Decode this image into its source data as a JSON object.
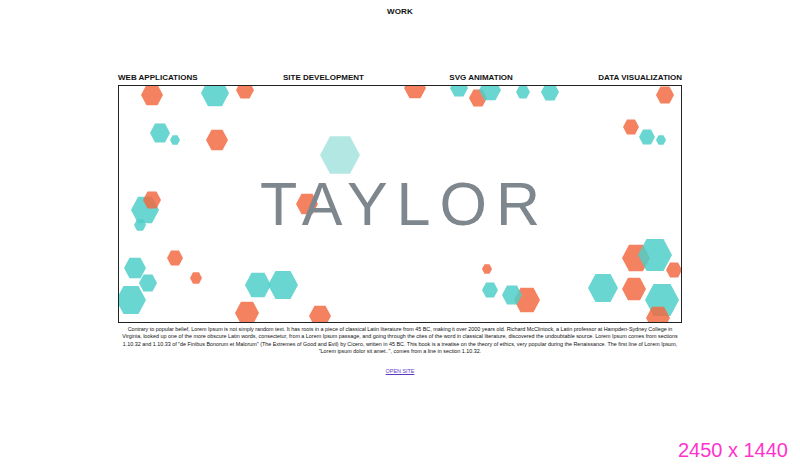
{
  "header": {
    "title": "WORK"
  },
  "categories": [
    {
      "label": "WEB APPLICATIONS"
    },
    {
      "label": "SITE DEVELOPMENT"
    },
    {
      "label": "SVG ANIMATION"
    },
    {
      "label": "DATA VISUALIZATION"
    }
  ],
  "hero": {
    "title": "TAYLOR",
    "shapes": [
      {
        "color": "#f26b43"
      },
      {
        "color": "#4fcfc9"
      },
      {
        "color": "#f26b43"
      },
      {
        "color": "#f26b43"
      },
      {
        "color": "#4fcfc9"
      },
      {
        "color": "#f26b43"
      },
      {
        "color": "#4fcfc9"
      },
      {
        "color": "#4fcfc9"
      },
      {
        "color": "#4fcfc9"
      },
      {
        "color": "#f26b43"
      },
      {
        "color": "#4fcfc9"
      },
      {
        "color": "#4fcfc9"
      },
      {
        "color": "#f26b43"
      },
      {
        "color": "#a6e3de"
      },
      {
        "color": "#f26b43"
      },
      {
        "color": "#4fcfc9"
      },
      {
        "color": "#4fcfc9"
      },
      {
        "color": "#f26b43"
      },
      {
        "color": "#4fcfc9"
      },
      {
        "color": "#f26b43"
      },
      {
        "color": "#4fcfc9"
      },
      {
        "color": "#f26b43"
      },
      {
        "color": "#4fcfc9"
      },
      {
        "color": "#4fcfc9"
      },
      {
        "color": "#f26b43"
      },
      {
        "color": "#4fcfc9"
      },
      {
        "color": "#4fcfc9"
      },
      {
        "color": "#f26b43"
      },
      {
        "color": "#f26b43"
      },
      {
        "color": "#4fcfc9"
      },
      {
        "color": "#f26b43"
      },
      {
        "color": "#4fcfc9"
      },
      {
        "color": "#f26b43"
      },
      {
        "color": "#4fcfc9"
      },
      {
        "color": "#f26b43"
      },
      {
        "color": "#4fcfc9"
      },
      {
        "color": "#f26b43"
      },
      {
        "color": "#4fcfc9"
      },
      {
        "color": "#f26b43"
      },
      {
        "color": "#4fcfc9"
      },
      {
        "color": "#f26b43"
      }
    ]
  },
  "description": "Contrary to popular belief, Lorem Ipsum is not simply random text. It has roots in a piece of classical Latin literature from 45 BC, making it over 2000 years old. Richard McClintock, a Latin professor at Hampden-Sydney College in Virginia, looked up one of the more obscure Latin words, consectetur, from a Lorem Ipsum passage, and going through the cites of the word in classical literature, discovered the undoubtable source. Lorem Ipsum comes from sections 1.10.32 and 1.10.33 of \"de Finibus Bonorum et Malorum\" (The Extremes of Good and Evil) by Cicero, written in 45 BC. This book is a treatise on the theory of ethics, very popular during the Renaissance. The first line of Lorem Ipsum, \"Lorem ipsum dolor sit amet..\", comes from a line in section 1.10.32.",
  "link": "OPEN SITE",
  "size_label": "2450 x 1440"
}
